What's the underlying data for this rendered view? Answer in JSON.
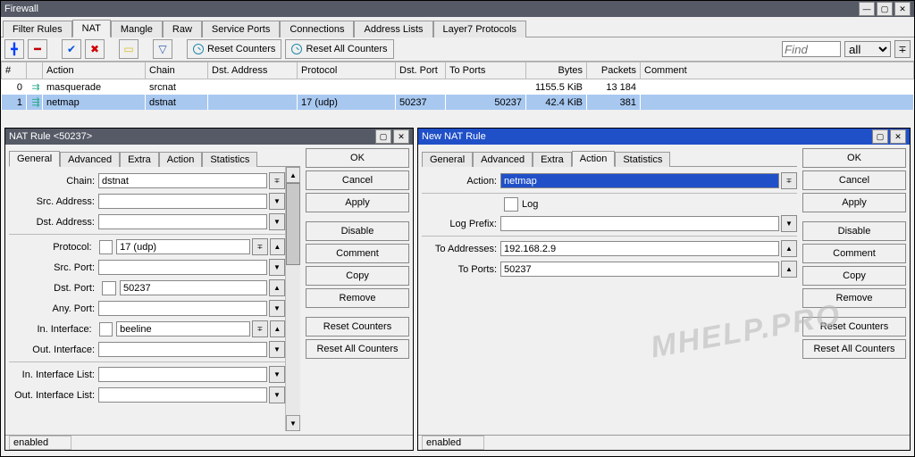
{
  "window": {
    "title": "Firewall"
  },
  "mainTabs": [
    "Filter Rules",
    "NAT",
    "Mangle",
    "Raw",
    "Service Ports",
    "Connections",
    "Address Lists",
    "Layer7 Protocols"
  ],
  "mainActiveTab": 1,
  "toolbar": {
    "resetCounters": "Reset Counters",
    "resetAll": "Reset All Counters",
    "findPlaceholder": "Find",
    "filterAll": "all"
  },
  "grid": {
    "cols": [
      "#",
      "",
      "Action",
      "Chain",
      "Dst. Address",
      "Protocol",
      "Dst. Port",
      "To Ports",
      "Bytes",
      "Packets",
      "Comment"
    ],
    "rows": [
      {
        "n": "0",
        "action": "masquerade",
        "chain": "srcnat",
        "dst": "",
        "proto": "",
        "dport": "",
        "toports": "",
        "bytes": "1155.5 KiB",
        "packets": "13 184",
        "comment": ""
      },
      {
        "n": "1",
        "action": "netmap",
        "chain": "dstnat",
        "dst": "",
        "proto": "17 (udp)",
        "dport": "50237",
        "toports": "50237",
        "bytes": "42.4 KiB",
        "packets": "381",
        "comment": ""
      }
    ]
  },
  "dlg1": {
    "title": "NAT Rule <50237>",
    "tabs": [
      "General",
      "Advanced",
      "Extra",
      "Action",
      "Statistics"
    ],
    "activeTab": 0,
    "fields": {
      "chain": {
        "label": "Chain:",
        "value": "dstnat"
      },
      "srcAddr": {
        "label": "Src. Address:",
        "value": ""
      },
      "dstAddr": {
        "label": "Dst. Address:",
        "value": ""
      },
      "protocol": {
        "label": "Protocol:",
        "value": "17 (udp)"
      },
      "srcPort": {
        "label": "Src. Port:",
        "value": ""
      },
      "dstPort": {
        "label": "Dst. Port:",
        "value": "50237"
      },
      "anyPort": {
        "label": "Any. Port:",
        "value": ""
      },
      "inIf": {
        "label": "In. Interface:",
        "value": "beeline"
      },
      "outIf": {
        "label": "Out. Interface:",
        "value": ""
      },
      "inIfList": {
        "label": "In. Interface List:",
        "value": ""
      },
      "outIfList": {
        "label": "Out. Interface List:",
        "value": ""
      }
    },
    "buttons": [
      "OK",
      "Cancel",
      "Apply",
      "Disable",
      "Comment",
      "Copy",
      "Remove",
      "Reset Counters",
      "Reset All Counters"
    ],
    "status": "enabled"
  },
  "dlg2": {
    "title": "New NAT Rule",
    "tabs": [
      "General",
      "Advanced",
      "Extra",
      "Action",
      "Statistics"
    ],
    "activeTab": 3,
    "fields": {
      "action": {
        "label": "Action:",
        "value": "netmap"
      },
      "log": {
        "label": "Log"
      },
      "logPrefix": {
        "label": "Log Prefix:",
        "value": ""
      },
      "toAddr": {
        "label": "To Addresses:",
        "value": "192.168.2.9"
      },
      "toPorts": {
        "label": "To Ports:",
        "value": "50237"
      }
    },
    "buttons": [
      "OK",
      "Cancel",
      "Apply",
      "Disable",
      "Comment",
      "Copy",
      "Remove",
      "Reset Counters",
      "Reset All Counters"
    ],
    "status": "enabled"
  },
  "watermark": "MHELP.PRO"
}
